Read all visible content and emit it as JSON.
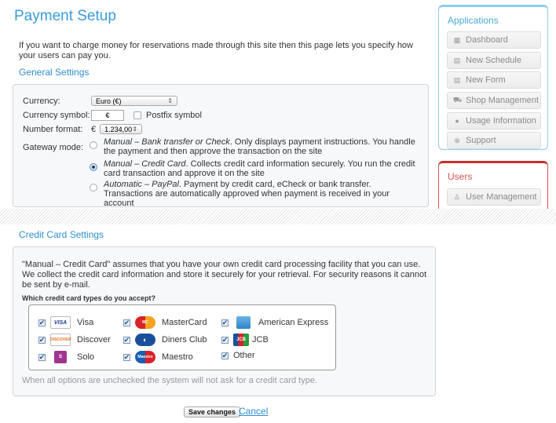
{
  "page": {
    "title": "Payment Setup",
    "intro": "If you want to charge money for reservations made through this site then this page lets you specify how your users can pay you."
  },
  "general": {
    "title": "General Settings",
    "currency_label": "Currency:",
    "currency_value": "Euro (€)",
    "symbol_label": "Currency symbol:",
    "symbol_value": "€",
    "postfix_label": "Postfix symbol",
    "postfix_checked": false,
    "number_label": "Number format:",
    "number_prefix": "€",
    "number_value": "1.234,00",
    "gateway_label": "Gateway mode:",
    "gateway_options": [
      {
        "name": "Manual – Bank transfer or Check",
        "desc": ". Only displays payment instructions. You handle the payment and then approve the transaction on the site",
        "selected": false
      },
      {
        "name": "Manual – Credit Card",
        "desc": ". Collects credit card information securely. You run the credit card transaction and approve it on the site",
        "selected": true
      },
      {
        "name": "Automatic – PayPal",
        "desc": ". Payment by credit card, eCheck or bank transfer. Transactions are automatically approved when payment is received in your account",
        "selected": false
      }
    ]
  },
  "credit": {
    "title": "Credit Card Settings",
    "description": "\"Manual – Credit Card\" assumes that you have your own credit card processing facility that you can use. We collect the credit card information and store it securely for your retrieval. For security reasons it cannot be sent by e-mail.",
    "question": "Which credit card types do you accept?",
    "cards": [
      {
        "label": "Visa",
        "icon": "visa-logo",
        "checked": true
      },
      {
        "label": "MasterCard",
        "icon": "mastercard-logo",
        "checked": true
      },
      {
        "label": "American Express",
        "icon": "amex-logo",
        "checked": true
      },
      {
        "label": "Discover",
        "icon": "discover-logo",
        "checked": true
      },
      {
        "label": "Diners Club",
        "icon": "diners-logo",
        "checked": true
      },
      {
        "label": "JCB",
        "icon": "jcb-logo",
        "checked": true
      },
      {
        "label": "Solo",
        "icon": "solo-logo",
        "checked": true
      },
      {
        "label": "Maestro",
        "icon": "maestro-logo",
        "checked": true
      },
      {
        "label": "Other",
        "icon": "",
        "checked": true
      }
    ],
    "note": "When all options are unchecked the system will not ask for a credit card type."
  },
  "actions": {
    "save": "Save changes",
    "cancel": "Cancel"
  },
  "sidebar": {
    "applications": {
      "title": "Applications",
      "items": [
        {
          "label": "Dashboard",
          "icon": "dashboard-icon"
        },
        {
          "label": "New Schedule",
          "icon": "calendar-icon"
        },
        {
          "label": "New Form",
          "icon": "form-icon"
        },
        {
          "label": "Shop Management",
          "icon": "cart-icon"
        },
        {
          "label": "Usage Information",
          "icon": "info-icon"
        },
        {
          "label": "Support",
          "icon": "lifebuoy-icon"
        }
      ]
    },
    "users": {
      "title": "Users",
      "items": [
        {
          "label": "User Management",
          "icon": "user-icon"
        }
      ]
    }
  },
  "colors": {
    "accent": "#2e8fd0",
    "apps_border": "#8fcbe4",
    "users_border": "#d9534f"
  }
}
